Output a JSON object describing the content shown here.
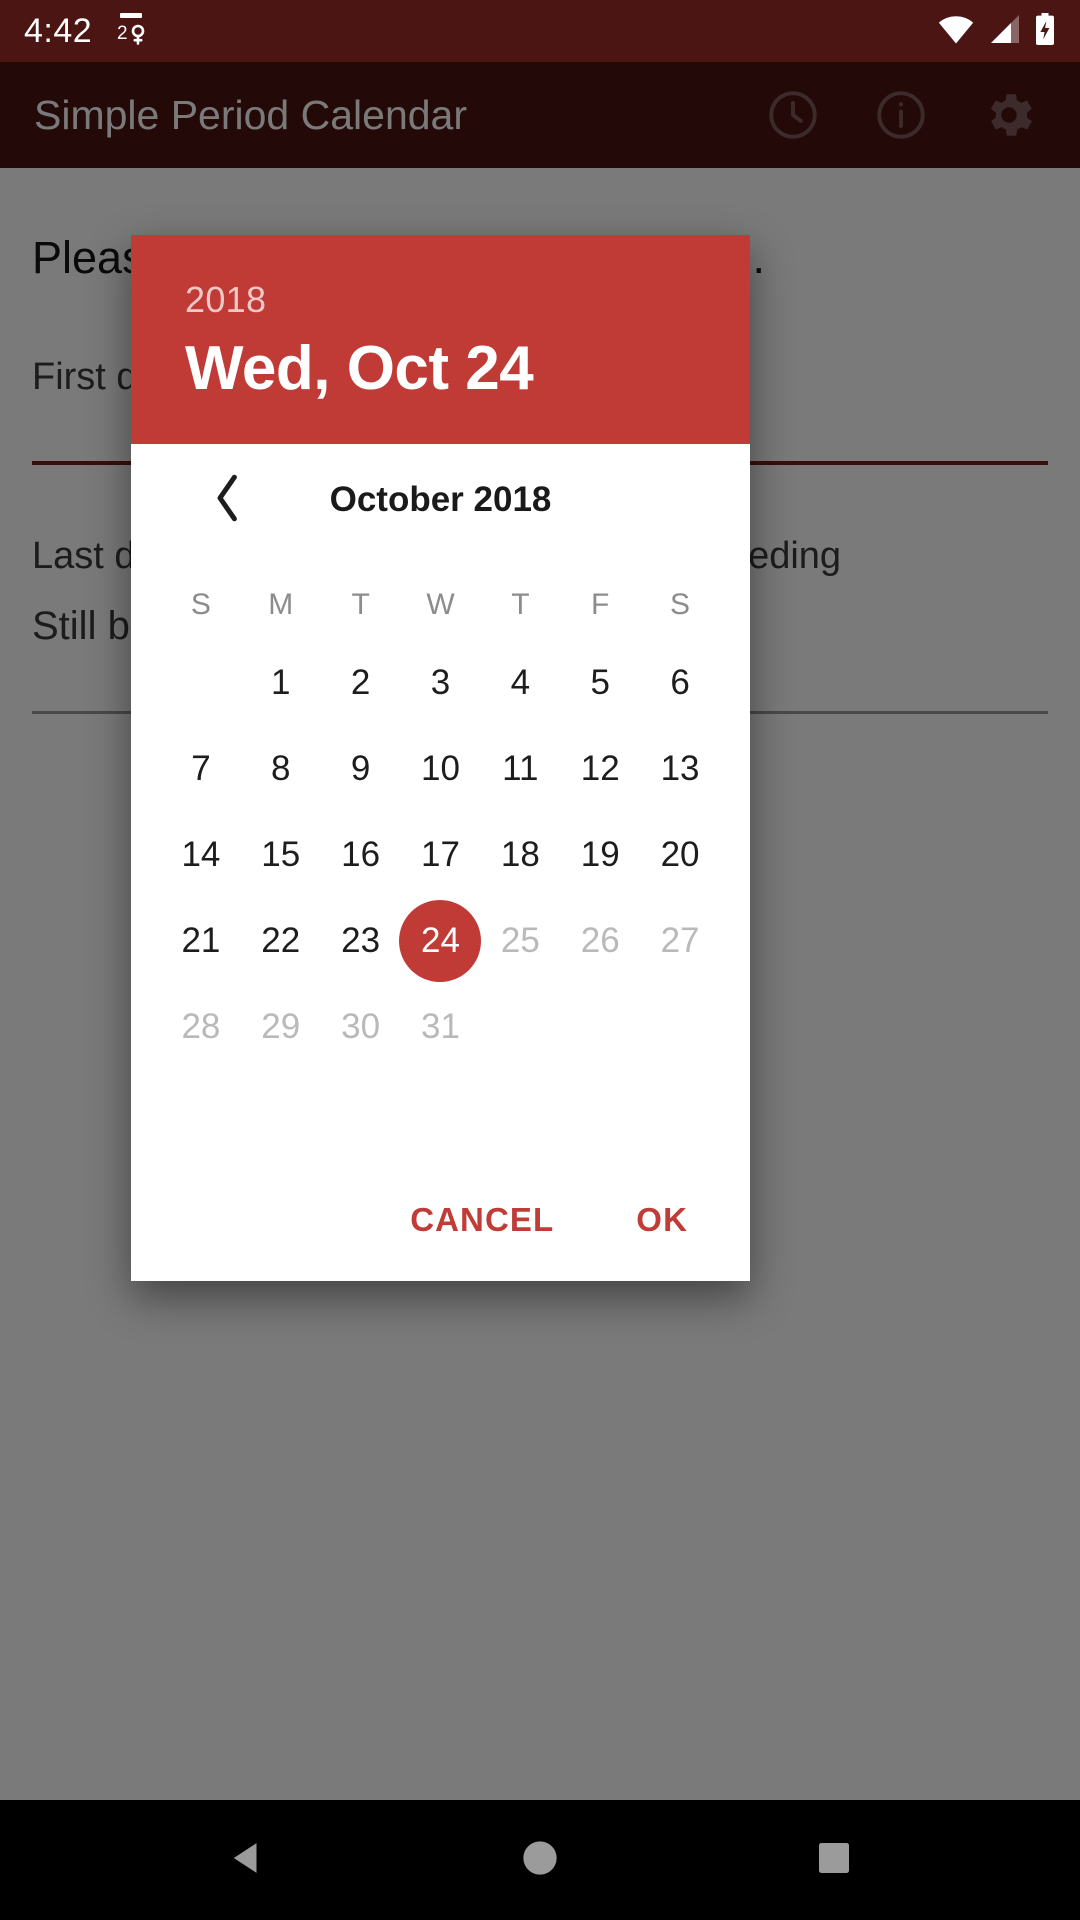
{
  "status_bar": {
    "time": "4:42",
    "notification_icon": "period-tracker-notification-icon",
    "wifi_icon": "wifi-icon",
    "signal_icon": "cellular-signal-icon",
    "battery_icon": "battery-charging-icon"
  },
  "app_bar": {
    "title": "Simple Period Calendar",
    "actions": [
      {
        "name": "history-clock-icon",
        "label": "History"
      },
      {
        "name": "info-icon",
        "label": "Info"
      },
      {
        "name": "gear-icon",
        "label": "Settings"
      }
    ]
  },
  "app_body": {
    "intro_text": "Please enter the last period you had.",
    "first_day_label": "First day",
    "last_day_label": "Last day of period, or leave blank if still bleeding",
    "still_bleeding_label": "Still bleeding"
  },
  "dialog": {
    "header": {
      "year": "2018",
      "date": "Wed, Oct 24"
    },
    "nav": {
      "prev_icon": "chevron-left-icon",
      "month_label": "October 2018"
    },
    "weekdays": [
      "S",
      "M",
      "T",
      "W",
      "T",
      "F",
      "S"
    ],
    "leading_blanks": 1,
    "days": [
      {
        "n": "1",
        "state": "enabled"
      },
      {
        "n": "2",
        "state": "enabled"
      },
      {
        "n": "3",
        "state": "enabled"
      },
      {
        "n": "4",
        "state": "enabled"
      },
      {
        "n": "5",
        "state": "enabled"
      },
      {
        "n": "6",
        "state": "enabled"
      },
      {
        "n": "7",
        "state": "enabled"
      },
      {
        "n": "8",
        "state": "enabled"
      },
      {
        "n": "9",
        "state": "enabled"
      },
      {
        "n": "10",
        "state": "enabled"
      },
      {
        "n": "11",
        "state": "enabled"
      },
      {
        "n": "12",
        "state": "enabled"
      },
      {
        "n": "13",
        "state": "enabled"
      },
      {
        "n": "14",
        "state": "enabled"
      },
      {
        "n": "15",
        "state": "enabled"
      },
      {
        "n": "16",
        "state": "enabled"
      },
      {
        "n": "17",
        "state": "enabled"
      },
      {
        "n": "18",
        "state": "enabled"
      },
      {
        "n": "19",
        "state": "enabled"
      },
      {
        "n": "20",
        "state": "enabled"
      },
      {
        "n": "21",
        "state": "enabled"
      },
      {
        "n": "22",
        "state": "enabled"
      },
      {
        "n": "23",
        "state": "enabled"
      },
      {
        "n": "24",
        "state": "selected"
      },
      {
        "n": "25",
        "state": "disabled"
      },
      {
        "n": "26",
        "state": "disabled"
      },
      {
        "n": "27",
        "state": "disabled"
      },
      {
        "n": "28",
        "state": "disabled"
      },
      {
        "n": "29",
        "state": "disabled"
      },
      {
        "n": "30",
        "state": "disabled"
      },
      {
        "n": "31",
        "state": "disabled"
      }
    ],
    "actions": {
      "cancel_label": "CANCEL",
      "ok_label": "OK"
    }
  },
  "nav_bar": {
    "back_icon": "back-triangle-icon",
    "home_icon": "home-circle-icon",
    "recents_icon": "recents-square-icon"
  },
  "colors": {
    "app_bar": "#4a1513",
    "dialog_accent": "#c03a36",
    "action_text": "#bf3c37",
    "scrim": "rgba(0,0,0,0.52)",
    "disabled_day": "#b9b9b9"
  }
}
